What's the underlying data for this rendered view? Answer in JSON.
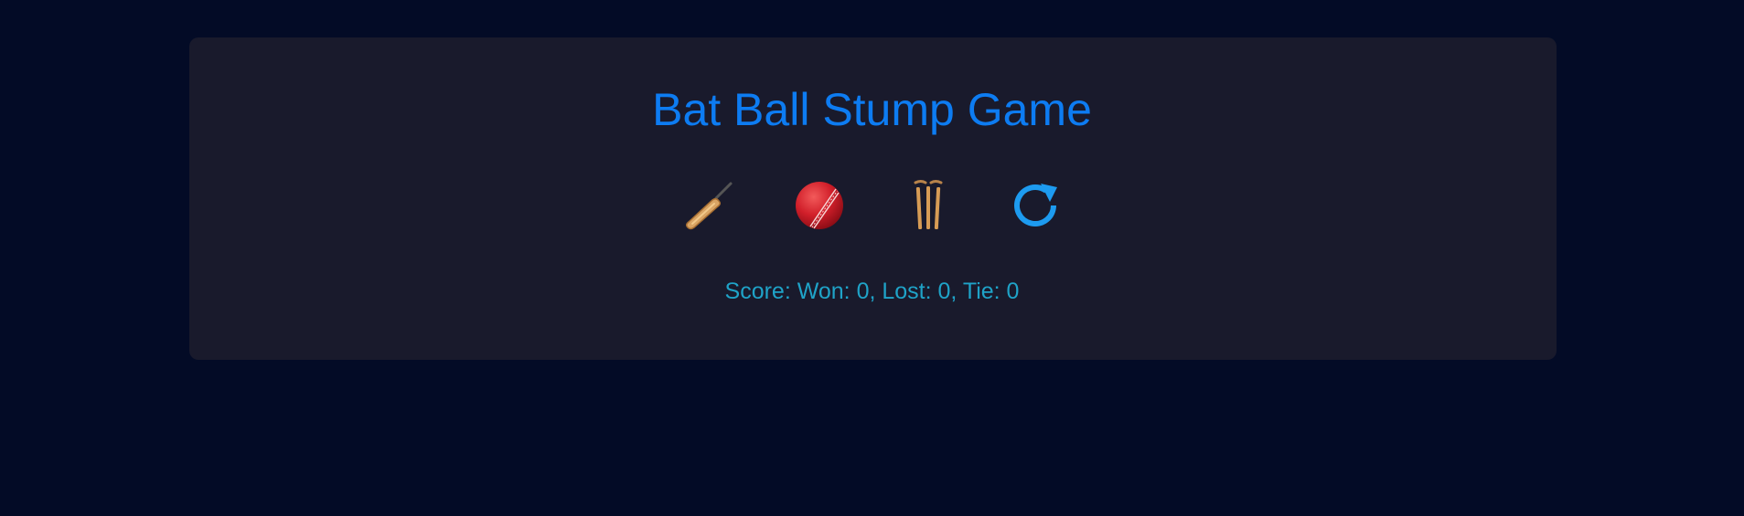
{
  "game": {
    "title": "Bat Ball Stump Game",
    "score_text": "Score: Won: 0, Lost: 0, Tie: 0"
  },
  "choices": [
    {
      "name": "bat",
      "icon": "cricket-bat-icon"
    },
    {
      "name": "ball",
      "icon": "cricket-ball-icon"
    },
    {
      "name": "stump",
      "icon": "cricket-stumps-icon"
    },
    {
      "name": "reset",
      "icon": "refresh-icon"
    }
  ],
  "colors": {
    "page_background": "#030b26",
    "card_background": "#191a2c",
    "title": "#0d7cf2",
    "score": "#1fa3c8",
    "reset_icon": "#1d9bf0"
  }
}
